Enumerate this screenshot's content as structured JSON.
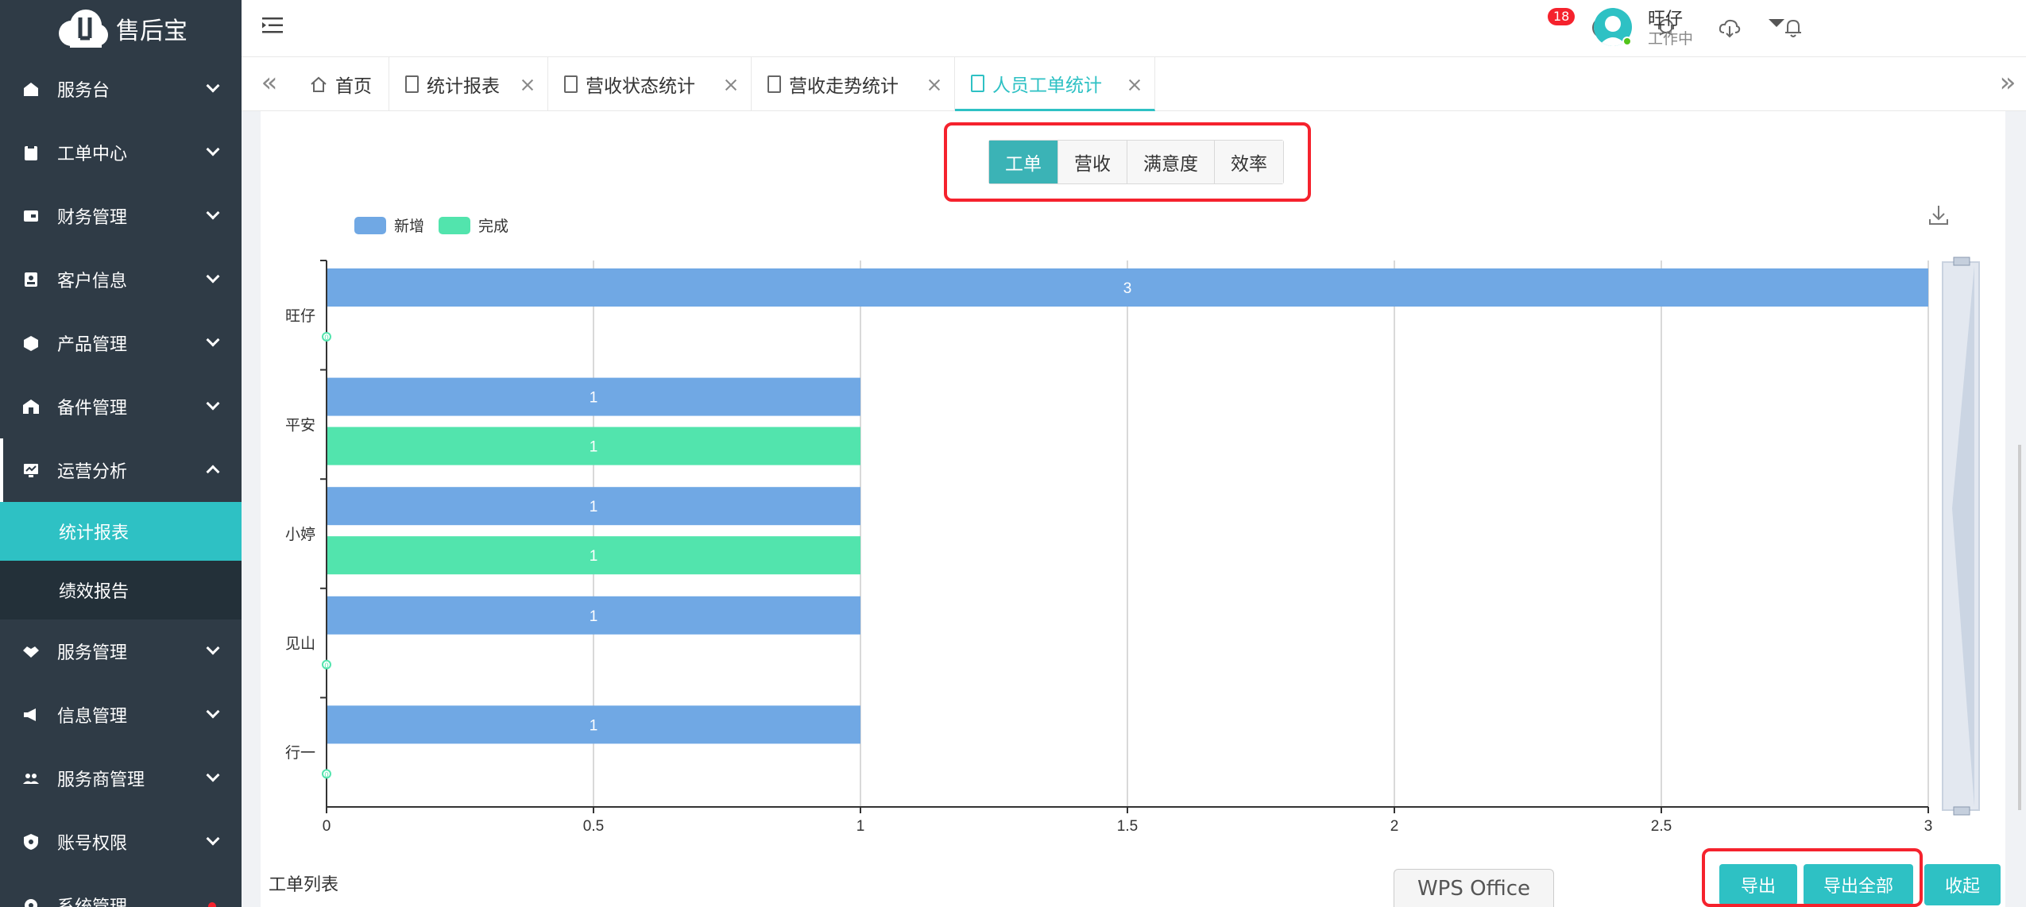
{
  "brand": {
    "name": "售后宝"
  },
  "sidebar": {
    "items": [
      {
        "label": "服务台",
        "icon": "monitor-icon"
      },
      {
        "label": "工单中心",
        "icon": "clipboard-icon"
      },
      {
        "label": "财务管理",
        "icon": "wallet-icon"
      },
      {
        "label": "客户信息",
        "icon": "contact-card-icon"
      },
      {
        "label": "产品管理",
        "icon": "box-icon"
      },
      {
        "label": "备件管理",
        "icon": "warehouse-icon"
      },
      {
        "label": "运营分析",
        "icon": "chart-monitor-icon",
        "expanded": true,
        "children": [
          {
            "label": "统计报表",
            "active": true
          },
          {
            "label": "绩效报告"
          }
        ]
      },
      {
        "label": "服务管理",
        "icon": "handshake-icon"
      },
      {
        "label": "信息管理",
        "icon": "megaphone-icon"
      },
      {
        "label": "服务商管理",
        "icon": "group-icon"
      },
      {
        "label": "账号权限",
        "icon": "shield-icon"
      },
      {
        "label": "系统管理",
        "icon": "gear-icon"
      }
    ]
  },
  "header": {
    "notification_count": "18",
    "user_name": "旺仔",
    "user_status": "工作中"
  },
  "tabs": [
    {
      "label": "首页",
      "icon": "home-icon"
    },
    {
      "label": "统计报表"
    },
    {
      "label": "营收状态统计"
    },
    {
      "label": "营收走势统计"
    },
    {
      "label": "人员工单统计",
      "active": true
    }
  ],
  "segment": {
    "options": [
      "工单",
      "营收",
      "满意度",
      "效率"
    ],
    "selected": "工单"
  },
  "chart_data": {
    "type": "bar",
    "orientation": "horizontal",
    "categories": [
      "旺仔",
      "平安",
      "小婷",
      "见山",
      "行一"
    ],
    "series": [
      {
        "name": "新增",
        "values": [
          3,
          1,
          1,
          1,
          1
        ],
        "color": "#70a8e4"
      },
      {
        "name": "完成",
        "values": [
          0,
          1,
          1,
          0,
          0
        ],
        "color": "#52e4ad"
      }
    ],
    "xlim": [
      0,
      3
    ],
    "xticks": [
      "0",
      "0.5",
      "1",
      "1.5",
      "2",
      "2.5",
      "3"
    ],
    "grid": true,
    "legend": "top-left"
  },
  "footer": {
    "list_title": "工单列表",
    "wps_label": "WPS Office",
    "export_label": "导出",
    "export_all_label": "导出全部",
    "collapse_label": "收起"
  },
  "colors": {
    "sidebar": "#2f3b46",
    "accent": "#2ec1c4",
    "highlight": "#f5222d"
  }
}
